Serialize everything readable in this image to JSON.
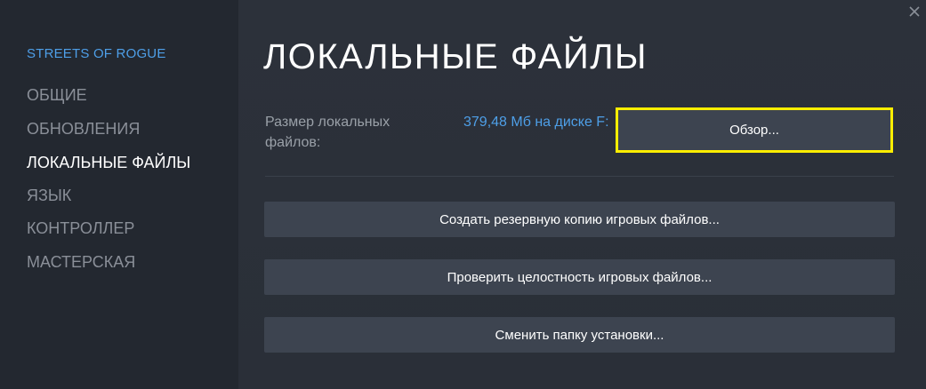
{
  "sidebar": {
    "game_title": "STREETS OF ROGUE",
    "items": [
      {
        "label": "ОБЩИЕ",
        "active": false
      },
      {
        "label": "ОБНОВЛЕНИЯ",
        "active": false
      },
      {
        "label": "ЛОКАЛЬНЫЕ ФАЙЛЫ",
        "active": true
      },
      {
        "label": "ЯЗЫК",
        "active": false
      },
      {
        "label": "КОНТРОЛЛЕР",
        "active": false
      },
      {
        "label": "МАСТЕРСКАЯ",
        "active": false
      }
    ]
  },
  "main": {
    "title": "ЛОКАЛЬНЫЕ ФАЙЛЫ",
    "size_label": "Размер локальных файлов:",
    "size_value": "379,48 Мб на диске F:",
    "browse_label": "Обзор...",
    "actions": [
      {
        "label": "Создать резервную копию игровых файлов..."
      },
      {
        "label": "Проверить целостность игровых файлов..."
      },
      {
        "label": "Сменить папку установки..."
      }
    ]
  },
  "icons": {
    "close": "close-icon"
  },
  "colors": {
    "accent": "#4e9fe8",
    "highlight_border": "#ffee00",
    "sidebar_bg": "#232830",
    "main_bg": "#2a2f38",
    "button_bg": "#3d4450"
  }
}
